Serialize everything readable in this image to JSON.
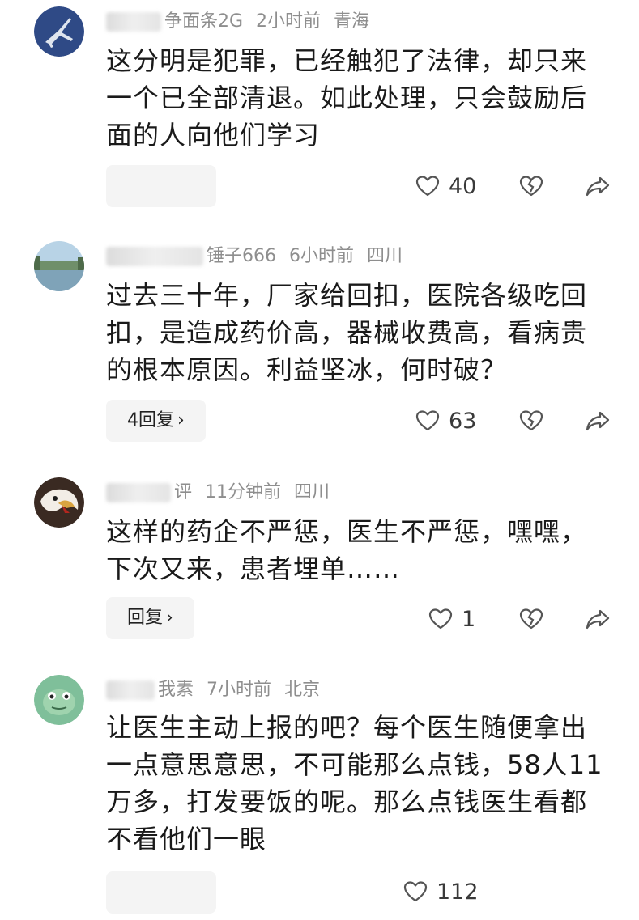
{
  "comments": [
    {
      "username": "争面条2G",
      "time": "2小时前",
      "location": "青海",
      "text": "这分明是犯罪，已经触犯了法律，却只来一个已全部清退。如此处理，只会鼓励后面的人向他们学习",
      "reply_label": "",
      "likes": "40",
      "avatar": "fighter-jet-avatar"
    },
    {
      "username": "锤子666",
      "time": "6小时前",
      "location": "四川",
      "text": "过去三十年，厂家给回扣，医院各级吃回扣，是造成药价高，器械收费高，看病贵的根本原因。利益坚冰，何时破？",
      "reply_label": "4回复",
      "likes": "63",
      "avatar": "landscape-avatar"
    },
    {
      "username": "评",
      "time": "11分钟前",
      "location": "四川",
      "text": "这样的药企不严惩，医生不严惩，嘿嘿，下次又来，患者埋单……",
      "reply_label": "回复",
      "likes": "1",
      "avatar": "eagle-avatar"
    },
    {
      "username": "我素",
      "time": "7小时前",
      "location": "北京",
      "text": "让医生主动上报的吧？每个医生随便拿出一点意思意思，不可能那么点钱，58人11万多，打发要饭的呢。那么点钱医生看都不看他们一眼",
      "reply_label": "",
      "likes": "112",
      "avatar": "frog-avatar"
    }
  ],
  "colors": {
    "meta_text": "#8e8e8e",
    "body_text": "#1a1a1a",
    "reply_bg": "#f4f4f4",
    "icon": "#555555"
  },
  "icons": [
    "heart-icon",
    "broken-heart-icon",
    "share-arrow-icon",
    "chevron-right-icon"
  ]
}
